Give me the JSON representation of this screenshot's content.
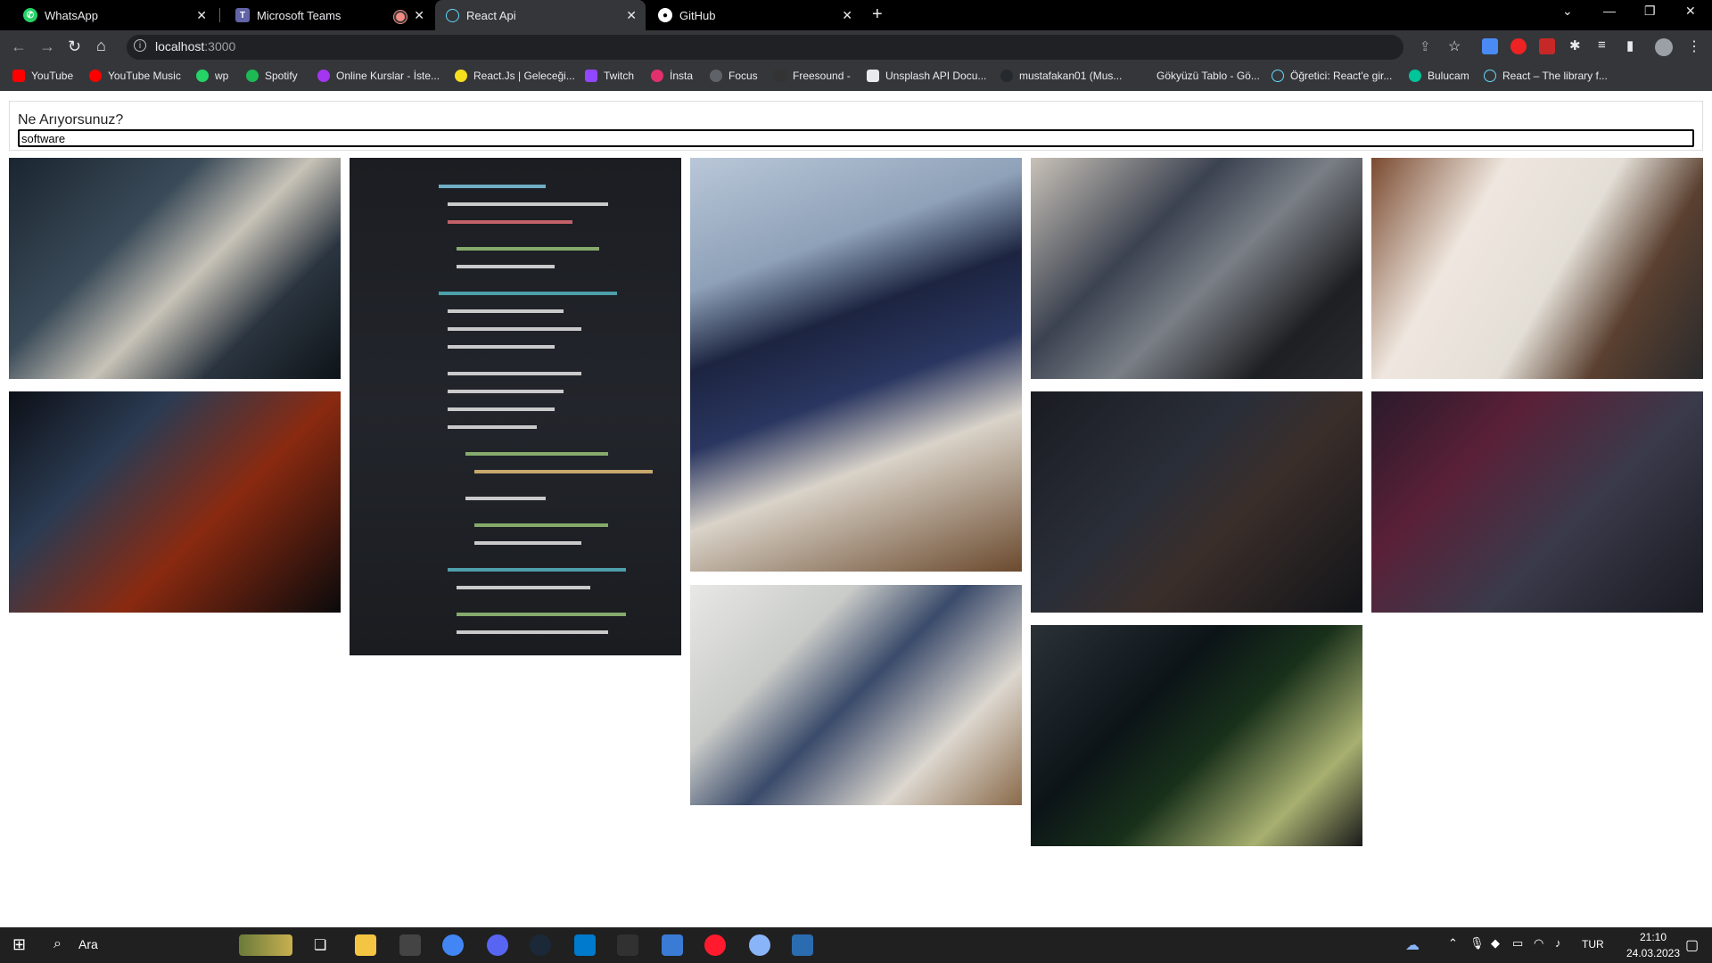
{
  "browser": {
    "tabs": [
      {
        "title": "WhatsApp",
        "icon": "whatsapp-icon",
        "color": "#25d366",
        "active": false
      },
      {
        "title": "Microsoft Teams",
        "icon": "teams-icon",
        "color": "#6264a7",
        "active": false
      },
      {
        "title": "React Api",
        "icon": "react-icon",
        "color": "#61dafb",
        "active": true
      },
      {
        "title": "GitHub",
        "icon": "github-icon",
        "color": "#ffffff",
        "active": false
      }
    ],
    "address": {
      "host": "localhost",
      "port": ":3000"
    },
    "bookmarks": [
      {
        "label": "YouTube",
        "color": "#ff0000"
      },
      {
        "label": "YouTube Music",
        "color": "#ff0000"
      },
      {
        "label": "wp",
        "color": "#25d366"
      },
      {
        "label": "Spotify",
        "color": "#1db954"
      },
      {
        "label": "Online Kurslar - İste...",
        "color": "#a435f0"
      },
      {
        "label": "React.Js | Geleceği...",
        "color": "#f7df1e"
      },
      {
        "label": "Twitch",
        "color": "#9146ff"
      },
      {
        "label": "İnsta",
        "color": "#e1306c"
      },
      {
        "label": "Focus",
        "color": "#5f6368"
      },
      {
        "label": "Freesound -",
        "color": "#333333"
      },
      {
        "label": "Unsplash API Docu...",
        "color": "#111111"
      },
      {
        "label": "mustafakan01 (Mus...",
        "color": "#24292e"
      },
      {
        "label": "Gökyüzü Tablo - Gö...",
        "color": "#35363a"
      },
      {
        "label": "Öğretici: React'e gir...",
        "color": "#61dafb"
      },
      {
        "label": "Bulucam",
        "color": "#00c49a"
      },
      {
        "label": "React – The library f...",
        "color": "#61dafb"
      }
    ]
  },
  "app": {
    "search_label": "Ne Arıyorsunuz?",
    "search_value": "software"
  },
  "photos": [
    {
      "name": "photo-hands-keyboard",
      "bg": "linear-gradient(135deg,#1a2530 0%,#3a4a58 35%,#c8c3b8 55%,#2b3540 75%,#0e1418 100%)"
    },
    {
      "name": "photo-code-vertical",
      "bg": "linear-gradient(180deg,#1b1d22 0%,#22252b 50%,#1a1c20 100%)"
    },
    {
      "name": "photo-curved-monitor",
      "bg": "linear-gradient(160deg,#b9c7d8 0%,#8ea1b8 25%,#1c2440 40%,#2a3660 55%,#d9d3c9 70%,#6b4a2e 100%)"
    },
    {
      "name": "photo-office-monitors",
      "bg": "linear-gradient(135deg,#c9c2b8 0%,#3b4250 35%,#7a7f86 55%,#1e1f22 80%,#2a2b2e 100%)"
    },
    {
      "name": "photo-two-women-laptop",
      "bg": "linear-gradient(120deg,#7a4a30 0%,#efe7df 30%,#e3ded6 55%,#5a4030 75%,#2a2a2c 100%)"
    },
    {
      "name": "photo-dual-monitors-red",
      "bg": "linear-gradient(135deg,#0d1017 0%,#2b3b52 30%,#8a2a10 60%,#0a0a0c 100%)"
    },
    {
      "name": "photo-code-angled",
      "bg": "linear-gradient(135deg,#1a1c22 0%,#2a2e38 40%,#3a2e2a 60%,#121418 100%)"
    },
    {
      "name": "photo-code-closeup-red",
      "bg": "linear-gradient(135deg,#2a1a2a 0%,#5a2038 30%,#3a3a4a 60%,#1a1a22 100%)"
    },
    {
      "name": "photo-man-at-desk",
      "bg": "linear-gradient(135deg,#e8e8e6 0%,#c9cbc8 30%,#3a4a6a 50%,#dcd7cf 75%,#8a6a4a 100%)"
    },
    {
      "name": "photo-laptop-code",
      "bg": "linear-gradient(135deg,#2a3238 0%,#0c1418 35%,#18301a 55%,#a8b070 80%,#1a1a1a 100%)"
    }
  ],
  "taskbar": {
    "search_placeholder": "Ara",
    "language": "TUR",
    "time": "21:10",
    "date": "24.03.2023"
  }
}
